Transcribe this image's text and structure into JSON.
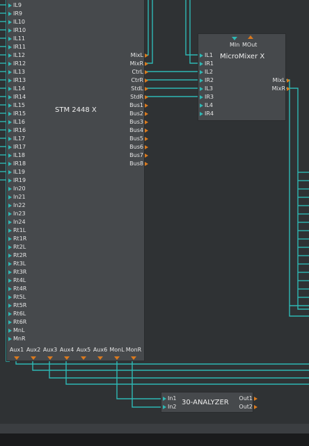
{
  "stm": {
    "title": "STM 2448 X",
    "inputs": [
      "IL9",
      "IR9",
      "IL10",
      "IR10",
      "IL11",
      "IR11",
      "IL12",
      "IR12",
      "IL13",
      "IR13",
      "IL14",
      "IR14",
      "IL15",
      "IR15",
      "IL16",
      "IR16",
      "IL17",
      "IR17",
      "IL18",
      "IR18",
      "IL19",
      "IR19",
      "In20",
      "In21",
      "In22",
      "In23",
      "In24",
      "Rt1L",
      "Rt1R",
      "Rt2L",
      "Rt2R",
      "Rt3L",
      "Rt3R",
      "Rt4L",
      "Rt4R",
      "Rt5L",
      "Rt5R",
      "Rt6L",
      "Rt6R",
      "MnL",
      "MnR"
    ],
    "outputs": [
      "MixL",
      "MixR",
      "CtrL",
      "CtrR",
      "StdL",
      "StdR",
      "Bus1",
      "Bus2",
      "Bus3",
      "Bus4",
      "Bus5",
      "Bus6",
      "Bus7",
      "Bus8"
    ],
    "aux_outputs": [
      "Aux1",
      "Aux2",
      "Aux3",
      "Aux4",
      "Aux5",
      "Aux6",
      "MonL",
      "MonR"
    ]
  },
  "micromixer": {
    "title": "MicroMixer X",
    "top_labels": [
      "MIn",
      "MOut"
    ],
    "inputs": [
      "IL1",
      "IR1",
      "IL2",
      "IR2",
      "IL3",
      "IR3",
      "IL4",
      "IR4"
    ],
    "outputs": [
      "MixL",
      "MixR"
    ]
  },
  "analyzer": {
    "title": "30-ANALYZER",
    "inputs": [
      "In1",
      "In2"
    ],
    "outputs": [
      "Out1",
      "Out2"
    ]
  },
  "colors": {
    "background": "#2f3234",
    "module": "#46494c",
    "cable": "#2fb8b4",
    "input_port": "#2fb8b4",
    "output_port": "#d97a1f"
  }
}
